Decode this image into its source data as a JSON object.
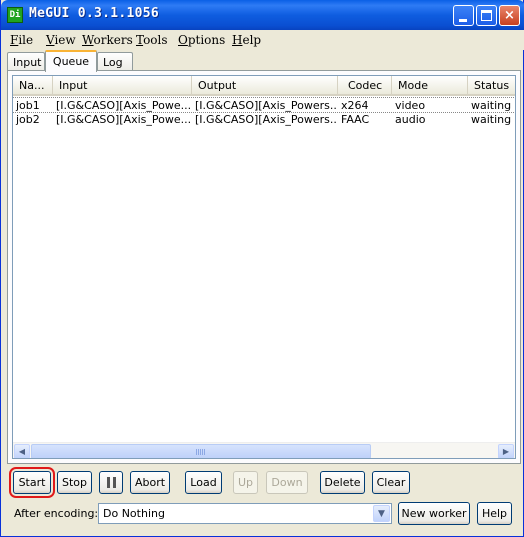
{
  "window": {
    "title": "MeGUI 0.3.1.1056",
    "icon_text": "Di",
    "controls": {
      "minimize": "minimize-icon",
      "maximize": "maximize-icon",
      "close": "×"
    }
  },
  "menu": [
    "File",
    "View",
    "Workers",
    "Tools",
    "Options",
    "Help"
  ],
  "tabs": [
    "Input",
    "Queue",
    "Log"
  ],
  "active_tab": "Queue",
  "table": {
    "columns": [
      "Na...",
      "Input",
      "Output",
      "Codec",
      "Mode",
      "Status"
    ],
    "rows": [
      [
        "job1",
        "[I.G&CASO][Axis_Powe...",
        "[I.G&CASO][Axis_Powers...",
        "x264",
        "video",
        "waiting"
      ],
      [
        "job2",
        "[I.G&CASO][Axis_Powe...",
        "[I.G&CASO][Axis_Powers...",
        "FAAC",
        "audio",
        "waiting"
      ]
    ]
  },
  "scrollbar": {
    "left_arrow": "◀",
    "right_arrow": "▶"
  },
  "buttons": {
    "start": "Start",
    "stop": "Stop",
    "abort": "Abort",
    "load": "Load",
    "up": "Up",
    "down": "Down",
    "delete": "Delete",
    "clear": "Clear",
    "new_worker": "New worker",
    "help": "Help"
  },
  "after_encoding": {
    "label": "After encoding:",
    "value": "Do Nothing",
    "arrow": "▼"
  },
  "colors": {
    "titlebar": "#0A5FE6",
    "highlight_ring": "#E01A1A",
    "tab_accent": "#F9B336"
  }
}
